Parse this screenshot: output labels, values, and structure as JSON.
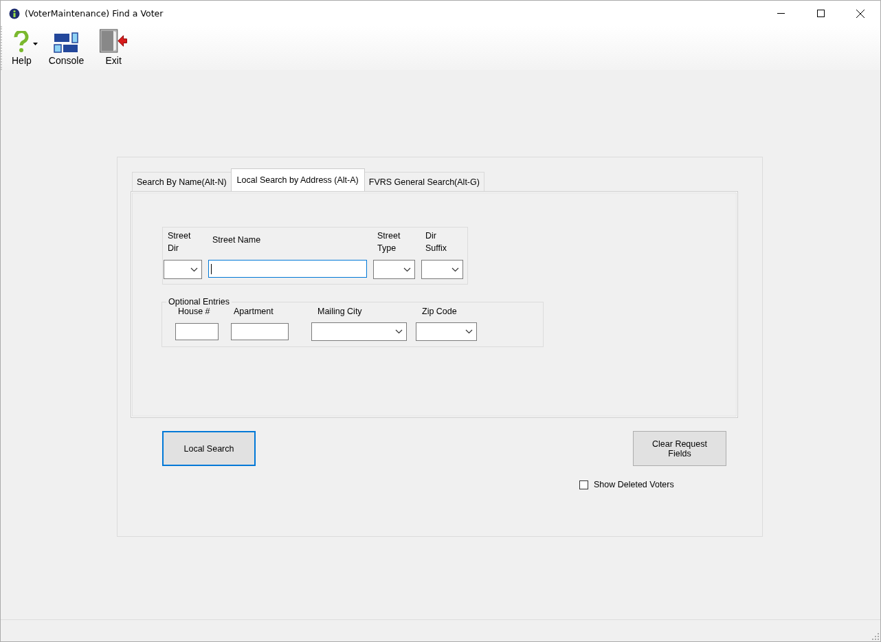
{
  "window": {
    "title": "(VoterMaintenance) Find a Voter"
  },
  "toolbar": [
    {
      "label": "Help",
      "kind": "help",
      "has_menu": true
    },
    {
      "label": "Console",
      "kind": "console",
      "has_menu": false
    },
    {
      "label": "Exit",
      "kind": "exit",
      "has_menu": false
    }
  ],
  "tabs": [
    {
      "label": "Search By Name(Alt-N)",
      "selected": false
    },
    {
      "label": "Local Search by Address (Alt-A)",
      "selected": true
    },
    {
      "label": "FVRS General Search(Alt-G)",
      "selected": false
    }
  ],
  "street_fields": [
    {
      "label": "Street\nDir",
      "kind": "combo"
    },
    {
      "label": "Street Name",
      "kind": "text",
      "focused": true
    },
    {
      "label": "Street\nType",
      "kind": "combo"
    },
    {
      "label": "Dir\nSuffix",
      "kind": "combo"
    }
  ],
  "optional_entries": {
    "title": "Optional Entries",
    "fields": [
      {
        "label": "House #",
        "kind": "text"
      },
      {
        "label": "Apartment",
        "kind": "text"
      },
      {
        "label": "Mailing City",
        "kind": "combo"
      },
      {
        "label": "Zip Code",
        "kind": "combo"
      }
    ]
  },
  "buttons": [
    {
      "label": "Local Search",
      "default": true
    },
    {
      "label": "Clear Request\nFields",
      "default": false
    }
  ],
  "show_deleted": {
    "label": "Show Deleted Voters",
    "checked": false
  }
}
